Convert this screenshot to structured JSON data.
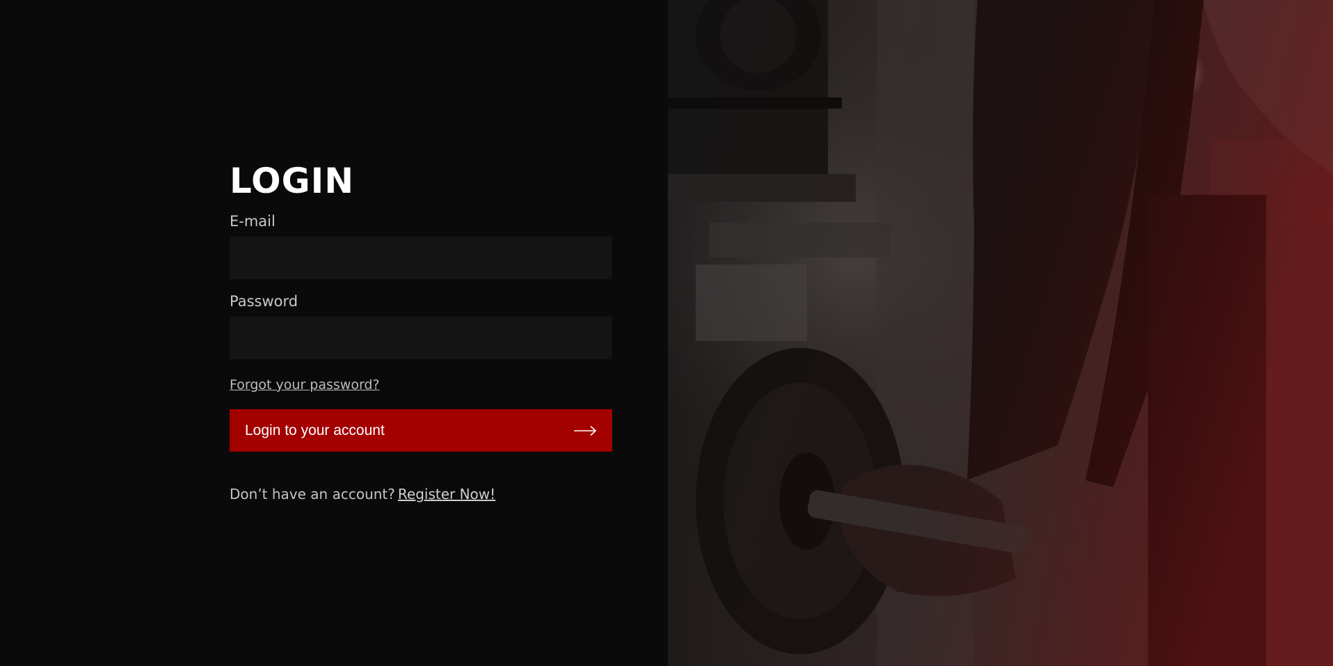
{
  "login": {
    "title": "LOGIN",
    "email_label": "E-mail",
    "email_value": "",
    "password_label": "Password",
    "password_value": "",
    "forgot_label": "Forgot your password?",
    "submit_label": "Login to your account",
    "register_prompt": "Don’t have an account?",
    "register_label": "Register Now!"
  },
  "icons": {
    "submit_icon": "arrow-right-icon"
  },
  "colors": {
    "background": "#0a0a0b",
    "accent": "#a30000",
    "input_background": "#141415"
  }
}
